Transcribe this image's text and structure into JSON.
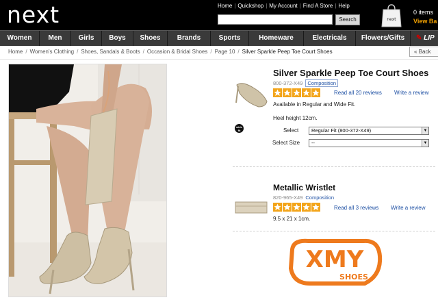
{
  "header": {
    "logo": "next",
    "top_links": [
      "Home",
      "Quickshop",
      "My Account",
      "Find A Store",
      "Help"
    ],
    "search_button": "Search",
    "search_value": "",
    "bag_count": "0 items",
    "bag_link": "View Ba"
  },
  "nav": {
    "items": [
      "Women",
      "Men",
      "Girls",
      "Boys",
      "Shoes",
      "Brands",
      "Sports",
      "Homeware",
      "Electricals",
      "Flowers/Gifts"
    ],
    "partner": "LIP"
  },
  "breadcrumb": {
    "items": [
      "Home",
      "Women's Clothing",
      "Shoes, Sandals & Boots",
      "Occasion & Bridal Shoes",
      "Page 10"
    ],
    "current": "Silver Sparkle Peep Toe Court Shoes",
    "back": "Back"
  },
  "product1": {
    "title": "Silver Sparkle Peep Toe Court Shoes",
    "code": "800-372-X49",
    "composition": "Composition",
    "rating": 5,
    "reviews": "Read all 20 reviews",
    "write_review": "Write a review",
    "desc1": "Available in Regular and Wide Fit.",
    "desc2": "Heel height 12cm.",
    "wide_fit_badge": "wide fit",
    "select_label": "Select",
    "select_value": "Regular Fit (800-372-X49)",
    "size_label": "Select Size",
    "size_value": "--"
  },
  "product2": {
    "title": "Metallic Wristlet",
    "code": "820-965-X49",
    "composition": "Composition",
    "rating": 5,
    "reviews": "Read all 3 reviews",
    "write_review": "Write a review",
    "desc": "9.5 x 21 x 1cm."
  },
  "watermark": {
    "line1": "XMY",
    "line2": "SHOES"
  },
  "colors": {
    "header_bg": "#000000",
    "nav_bg": "#3a3a3a",
    "star": "#f3a51b",
    "link": "#1d4fa3",
    "watermark": "#ee7a1d"
  }
}
